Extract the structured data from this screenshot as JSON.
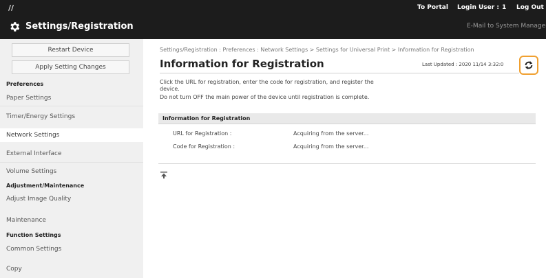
{
  "header": {
    "logo_text": "//",
    "app_title": "Settings/Registration",
    "to_portal": "To Portal",
    "login_user_label": "Login User :",
    "login_user_value": "1",
    "logout": "Log Out",
    "email_admin": "E-Mail to System Manager"
  },
  "sidebar": {
    "restart_button": "Restart Device",
    "apply_button": "Apply Setting Changes",
    "groups": {
      "preferences": "Preferences",
      "adjustment": "Adjustment/Maintenance",
      "function": "Function Settings"
    },
    "items": {
      "paper": "Paper Settings",
      "timer": "Timer/Energy Settings",
      "network": "Network Settings",
      "external": "External Interface",
      "volume": "Volume Settings",
      "adjust_image": "Adjust Image Quality",
      "maintenance": "Maintenance",
      "common": "Common Settings",
      "copy": "Copy"
    },
    "active_item": "Network Settings"
  },
  "main": {
    "breadcrumb": "Settings/Registration : Preferences : Network Settings > Settings for Universal Print > Information for Registration",
    "title": "Information for Registration",
    "last_updated": "Last Updated : 2020 11/14 3:32:0",
    "description_line1": "Click the URL for registration, enter the code for registration, and register the",
    "description_line2": "device.",
    "description_line3": "Do not turn OFF the main power of the device until registration is complete.",
    "table": {
      "heading": "Information for Registration",
      "rows": [
        {
          "label": "URL for Registration :",
          "value": "Acquiring from the server..."
        },
        {
          "label": "Code for Registration :",
          "value": "Acquiring from the server..."
        }
      ]
    },
    "to_top_icon": "back-to-top-icon",
    "refresh_icon": "refresh-icon"
  },
  "colors": {
    "header_bg": "#1c1c1c",
    "sidebar_bg": "#f0f0f0",
    "refresh_highlight": "#f0a030"
  }
}
